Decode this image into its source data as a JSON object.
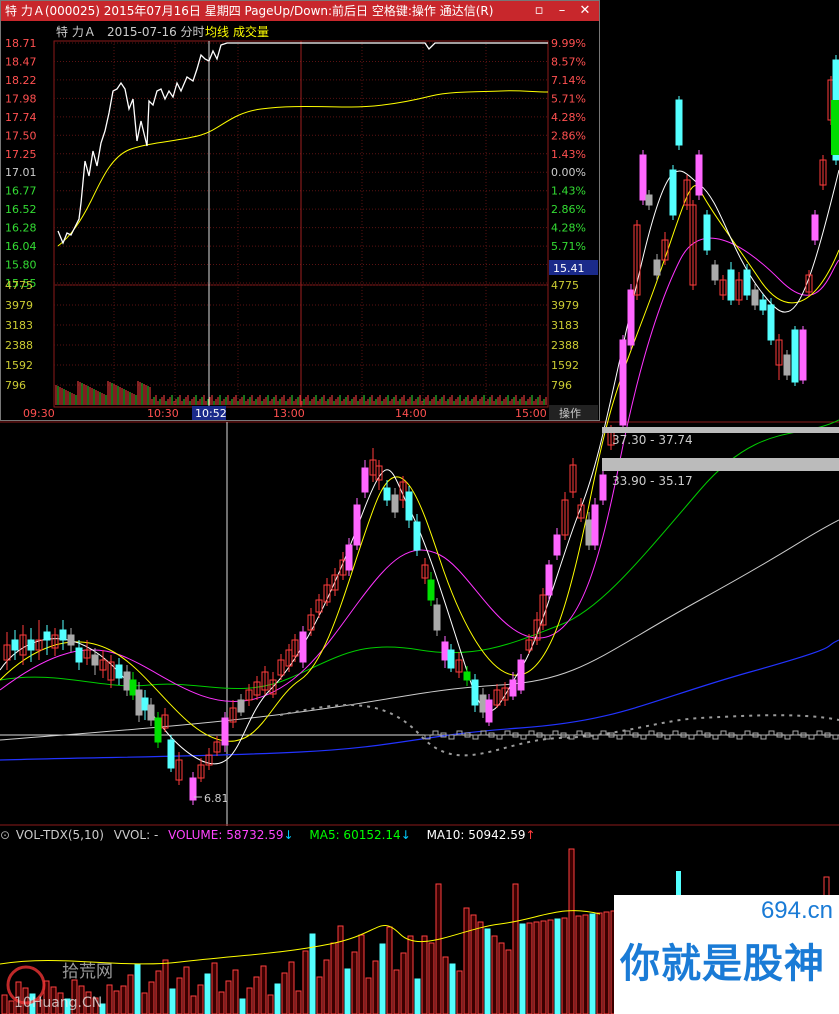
{
  "window": {
    "title": "特 力Ａ(000025)  2015年07月16日 星期四 PageUp/Down:前后日 空格键:操作 通达信(R)"
  },
  "intraday": {
    "stock_name": "特 力Ａ",
    "date_label": "2015-07-16 分时",
    "avg_line_label": "均线",
    "volume_label": "成交量",
    "price_ticks": [
      "18.71",
      "18.47",
      "18.22",
      "17.98",
      "17.74",
      "17.50",
      "17.25",
      "17.01",
      "16.77",
      "16.52",
      "16.28",
      "16.04",
      "15.80",
      "15.55"
    ],
    "pct_ticks": [
      "9.99%",
      "8.57%",
      "7.14%",
      "5.71%",
      "4.28%",
      "2.86%",
      "1.43%",
      "0.00%",
      "1.43%",
      "2.86%",
      "4.28%",
      "5.71%",
      "7.14%"
    ],
    "current_price_badge": "15.41",
    "volume_ticks": [
      "4775",
      "3979",
      "3183",
      "2388",
      "1592",
      "796"
    ],
    "time_ticks": [
      "09:30",
      "10:30",
      "10:52",
      "13:00",
      "14:00",
      "15:00"
    ],
    "cursor_time": "10:52",
    "action_button": "操作",
    "colors": {
      "price_line": "#ffffff",
      "avg_line": "#ffff00",
      "up": "#ff3232",
      "down": "#00e600",
      "grid": "#8b1a1a"
    }
  },
  "kline": {
    "range_label_1": "37.30 - 37.74",
    "range_label_2": "33.90 - 35.17",
    "low_label": "6.81",
    "colors": {
      "up": "#ff3c3c",
      "down_cyan": "#54ffff",
      "limit_up": "#ff66ff",
      "ma5": "#ffffff",
      "ma10": "#ffff00",
      "ma20": "#ff00ff",
      "ma30": "#00ff00",
      "ma60": "#cccccc",
      "ma120": "#0000ff"
    }
  },
  "volume_panel": {
    "indicator": "VOL-TDX(5,10)",
    "vvol": "VVOL: -",
    "volume_text": "VOLUME: 58732.59",
    "ma5_text": "MA5: 60152.14",
    "ma10_text": "MA10: 50942.59",
    "colors": {
      "volume": "#ff66ff",
      "ma5": "#00ff00",
      "ma10": "#ffffff",
      "arrow_down": "#00ccff",
      "arrow_up": "#ff3c3c"
    }
  },
  "watermarks": {
    "left_brand": "拾荒网",
    "left_url": "10Huang.CN",
    "right_url": "694.cn",
    "right_slogan": "你就是股神"
  }
}
